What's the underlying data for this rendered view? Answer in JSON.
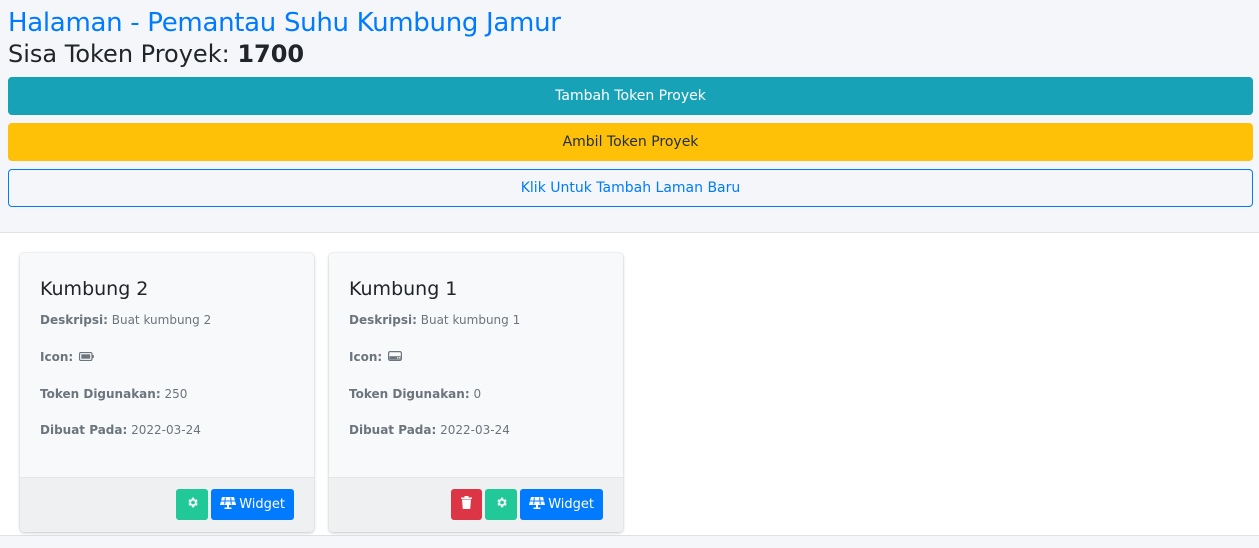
{
  "page": {
    "title": "Halaman - Pemantau Suhu Kumbung Jamur",
    "token_label": "Sisa Token Proyek: ",
    "token_value": "1700"
  },
  "buttons": {
    "add_token": "Tambah Token Proyek",
    "take_token": "Ambil Token Proyek",
    "add_page": "Klik Untuk Tambah Laman Baru"
  },
  "field_labels": {
    "description": "Deskripsi:",
    "icon": "Icon:",
    "tokens_used": "Token Digunakan:",
    "created_at": "Dibuat Pada:"
  },
  "cards": [
    {
      "title": "Kumbung 2",
      "description": "Buat kumbung 2",
      "icon": "battery-icon",
      "tokens_used": "250",
      "created_at": "2022-03-24",
      "widget_label": "Widget"
    },
    {
      "title": "Kumbung 1",
      "description": "Buat kumbung 1",
      "icon": "hdd-icon",
      "tokens_used": "0",
      "created_at": "2022-03-24",
      "widget_label": "Widget"
    }
  ],
  "colors": {
    "title": "#007bff",
    "info": "#17a2b8",
    "warning": "#ffc107",
    "success": "#20c997",
    "danger": "#dc3545",
    "primary": "#007bff"
  }
}
